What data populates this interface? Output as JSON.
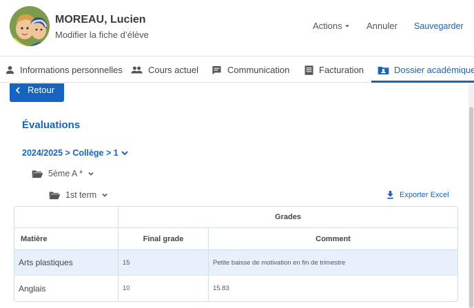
{
  "header": {
    "student_name": "MOREAU, Lucien",
    "subtitle": "Modifier la fiche d’élève",
    "actions_label": "Actions",
    "cancel_label": "Annuler",
    "save_label": "Sauvegarder"
  },
  "tabs": [
    {
      "label": "Informations personnelles",
      "icon": "person-icon"
    },
    {
      "label": "Cours actuel",
      "icon": "people-icon"
    },
    {
      "label": "Communication",
      "icon": "chat-icon"
    },
    {
      "label": "Facturation",
      "icon": "document-icon"
    },
    {
      "label": "Dossier académique",
      "icon": "id-card-icon",
      "active": true
    }
  ],
  "main": {
    "back_label": "Retour",
    "section_title": "Évaluations",
    "breadcrumb": "2024/2025 > Collège > 1",
    "class_folder": "5ème A *",
    "term_folder": "1st term",
    "export_label": "Exporter Excel"
  },
  "table": {
    "group_header": "Grades",
    "columns": [
      "Matière",
      "Final grade",
      "Comment"
    ],
    "rows": [
      {
        "subject": "Arts plastiques",
        "final_grade": "15",
        "comment": "Petite baisse de motivation en fin de trimestre"
      },
      {
        "subject": "Anglais",
        "final_grade": "10",
        "comment": "15.83"
      }
    ]
  },
  "colors": {
    "accent": "#1565c0",
    "row_highlight": "#e8f0fb",
    "table_border": "#cfe0ea"
  }
}
